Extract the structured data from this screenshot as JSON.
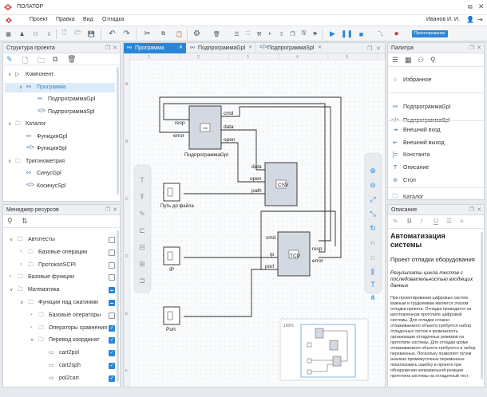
{
  "app": {
    "title": "ПОЛАТОР",
    "user": "Иванов И. И."
  },
  "menu": [
    "Проект",
    "Правка",
    "Вид",
    "Отладка"
  ],
  "toolbar": {
    "badge": "Проектирование"
  },
  "project_tree": {
    "title": "Структура проекта",
    "items": [
      {
        "label": "Компонент",
        "level": 0,
        "icon": "component-icon",
        "expanded": true
      },
      {
        "label": "Программа",
        "level": 1,
        "icon": "program-icon",
        "expanded": true,
        "selected": true
      },
      {
        "label": "ПодпрограммаGpl",
        "level": 2,
        "icon": "subprogram-gpl-icon"
      },
      {
        "label": "ПодпрограммаSpl",
        "level": 2,
        "icon": "subprogram-spl-icon"
      },
      {
        "label": "Каталог",
        "level": 0,
        "icon": "folder-icon",
        "expanded": true
      },
      {
        "label": "ФункцияGpl",
        "level": 1,
        "icon": "function-gpl-icon"
      },
      {
        "label": "ФункцияSpl",
        "level": 1,
        "icon": "function-spl-icon"
      },
      {
        "label": "Тригонометрия",
        "level": 0,
        "icon": "folder-icon",
        "expanded": true
      },
      {
        "label": "СинусGpl",
        "level": 1,
        "icon": "function-gpl-icon"
      },
      {
        "label": "КосинусSpl",
        "level": 1,
        "icon": "function-spl-icon"
      }
    ]
  },
  "resource_manager": {
    "title": "Менеджер ресурсов",
    "items": [
      {
        "label": "Автотесты",
        "level": 0,
        "arrow": "down",
        "check": "off"
      },
      {
        "label": "Базовые операции",
        "level": 1,
        "arrow": "right",
        "check": "off"
      },
      {
        "label": "ПротоколSCPI",
        "level": 1,
        "arrow": "right",
        "check": "off"
      },
      {
        "label": "Базовые функции",
        "level": 0,
        "arrow": "right",
        "check": "off"
      },
      {
        "label": "Математика",
        "level": 0,
        "arrow": "down",
        "check": "partial"
      },
      {
        "label": "Функции над сжатиями",
        "level": 1,
        "arrow": "down",
        "check": "partial"
      },
      {
        "label": "Базовые операторы",
        "level": 2,
        "arrow": "right",
        "check": "off"
      },
      {
        "label": "Операторы сравнения",
        "level": 2,
        "arrow": "right",
        "check": "on"
      },
      {
        "label": "Перевод координат",
        "level": 2,
        "arrow": "down",
        "check": "on"
      },
      {
        "label": "cart2pol",
        "level": 3,
        "arrow": "",
        "check": "on"
      },
      {
        "label": "cart2sph",
        "level": 3,
        "arrow": "",
        "check": "on"
      },
      {
        "label": "pol2cart",
        "level": 3,
        "arrow": "",
        "check": "on"
      }
    ]
  },
  "tabs": [
    {
      "label": "Программа",
      "icon": "program-icon",
      "active": true
    },
    {
      "label": "ПодпрограммаGpl",
      "icon": "subprogram-gpl-icon",
      "active": false
    },
    {
      "label": "ПодпрограммаSpl",
      "icon": "subprogram-spl-icon",
      "active": false
    }
  ],
  "ruler": {
    "columns": [
      "1",
      "2",
      "3",
      "4",
      "5"
    ],
    "rows": [
      "A",
      "B",
      "C",
      "D",
      "E",
      "F"
    ]
  },
  "diagram": {
    "blocks": [
      {
        "name": "ПодпрограммаGpl",
        "caption": "ПодпрограммаGpl",
        "inputs": [
          "resp",
          "error"
        ],
        "outputs": [
          "cmd",
          "data",
          "open"
        ]
      },
      {
        "name": "CSV",
        "caption": "",
        "inputs": [
          "data",
          "open",
          "path"
        ],
        "outputs": []
      },
      {
        "name": "TCP",
        "caption": "",
        "inputs": [
          "cmd",
          "ip",
          "port"
        ],
        "outputs": [
          "resp",
          "error"
        ]
      }
    ],
    "constants": [
      {
        "caption": "Путь до файла"
      },
      {
        "caption": "IP"
      },
      {
        "caption": "Port"
      }
    ],
    "minimap_zoom": "100%"
  },
  "palette": {
    "title": "Палитра",
    "items": [
      {
        "label": "Избранное",
        "icon": "favorites-icon"
      },
      {
        "label": "ПодпрограммаGpl",
        "icon": "subprogram-gpl-icon"
      },
      {
        "label": "ПодпрограммаSpl",
        "icon": "subprogram-spl-icon"
      },
      {
        "label": "Внешний вход",
        "icon": "external-input-icon"
      },
      {
        "label": "Внешний выход",
        "icon": "external-output-icon"
      },
      {
        "label": "Константа",
        "icon": "constant-icon"
      },
      {
        "label": "Описание",
        "icon": "description-icon"
      },
      {
        "label": "Стоп",
        "icon": "stop-icon"
      },
      {
        "label": "Каталог",
        "icon": "folder-icon"
      }
    ]
  },
  "description": {
    "title": "Описание",
    "heading": "Автоматизация системы",
    "subheading": "Проект отладки оборудования",
    "italic": "Результаты цикла тестов с последовательностью входящих данных",
    "body": "При проектировании цифровых систем важным и трудоемким является этапом отладки проекта. Отладка проводится на изготовленном прототипе цифровой системы. Для отладки сложно отлаживаемого объекта требуется набор отладочных тестов и возможность организации отладочных режимов на прототипе системы. Для отладки кроме отлаживаемого объекта требуются и набор переменных. Поскольку позволяет путем анализа промежуточных переменных локализовать ошибку в проекте при обнаружении неправильной реакции прототипа системы на отладочный тест."
  },
  "colors": {
    "accent": "#2a86d6",
    "block_fill": "#d3d9e0",
    "tab_bg": "#2a86d6"
  }
}
